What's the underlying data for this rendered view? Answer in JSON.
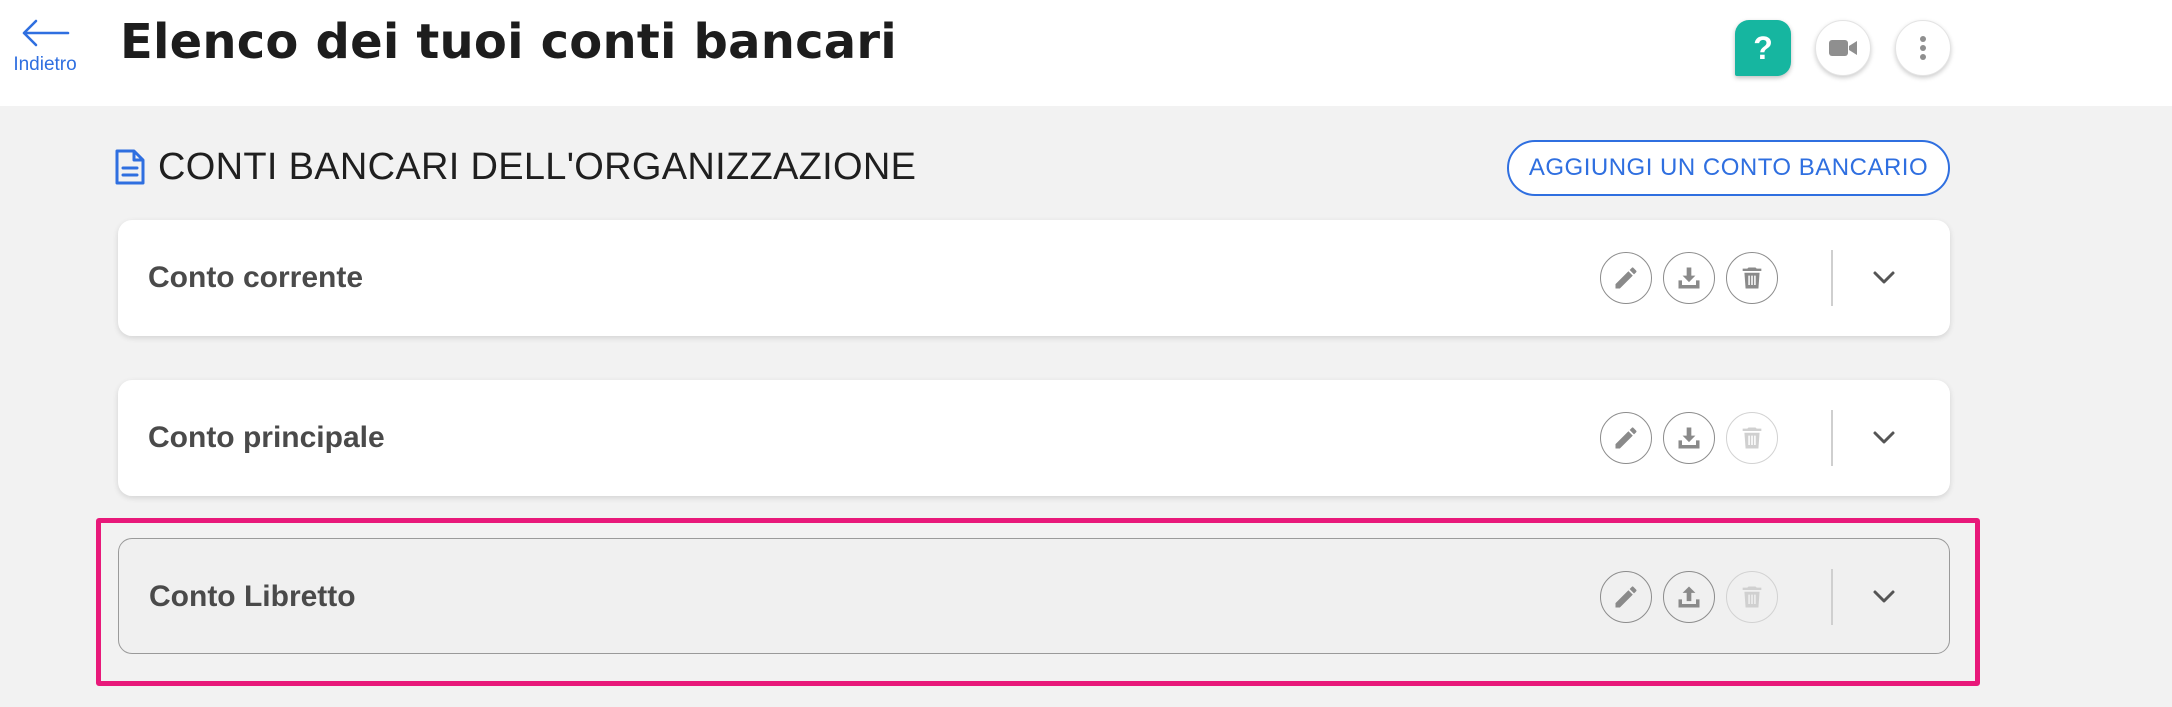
{
  "header": {
    "back_label": "Indietro",
    "title": "Elenco dei tuoi conti bancari",
    "help_label": "?"
  },
  "section": {
    "title": "CONTI BANCARI DELL'ORGANIZZAZIONE",
    "add_button_label": "AGGIUNGI UN CONTO BANCARIO"
  },
  "accounts": [
    {
      "name": "Conto corrente",
      "delete_enabled": true,
      "highlighted": false
    },
    {
      "name": "Conto principale",
      "delete_enabled": false,
      "highlighted": false
    },
    {
      "name": "Conto Libretto",
      "delete_enabled": false,
      "highlighted": true
    }
  ],
  "colors": {
    "accent_blue": "#2f6fe0",
    "help_teal": "#16b6a0",
    "highlight_pink": "#e8197a"
  }
}
